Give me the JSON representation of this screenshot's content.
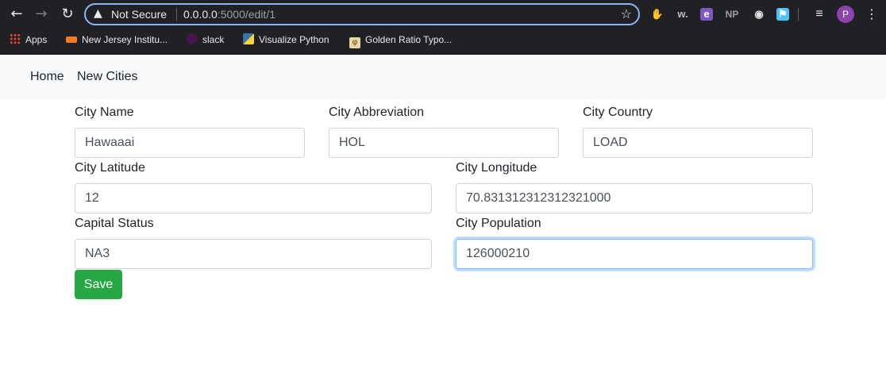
{
  "browser": {
    "security_label": "Not Secure",
    "url_host": "0.0.0.0",
    "url_rest": ":5000/edit/1",
    "profile_initial": "P",
    "bookmarks": [
      {
        "label": "Apps",
        "icon": "apps-grid-icon"
      },
      {
        "label": "New Jersey Institu...",
        "icon": "njit-icon",
        "color": "#f47b20"
      },
      {
        "label": "slack",
        "icon": "slack-icon",
        "color": "#4a154b"
      },
      {
        "label": "Visualize Python",
        "icon": "python-icon",
        "color": "#3776ab"
      },
      {
        "label": "Golden Ratio Typo...",
        "icon": "phi-icon",
        "color": "#e9d8a6"
      }
    ],
    "extensions": [
      {
        "name": "adblock-icon",
        "glyph": "✋",
        "color": "#e53935"
      },
      {
        "name": "w-extension-icon",
        "glyph": "w.",
        "color": "#bdbdbd"
      },
      {
        "name": "e-extension-icon",
        "glyph": "e",
        "color": "#7e57c2"
      },
      {
        "name": "np-extension-icon",
        "glyph": "NP",
        "color": "#9e9e9e"
      },
      {
        "name": "circle-extension-icon",
        "glyph": "◉",
        "color": "#e0e0e0"
      },
      {
        "name": "person-extension-icon",
        "glyph": "⚑",
        "color": "#4fc3f7"
      },
      {
        "name": "reading-list-icon",
        "glyph": "≡",
        "color": "#e8eaed"
      }
    ]
  },
  "navbar": {
    "home": "Home",
    "new_cities": "New Cities"
  },
  "form": {
    "city_name": {
      "label": "City Name",
      "value": "Hawaaai"
    },
    "city_abbreviation": {
      "label": "City Abbreviation",
      "value": "HOL"
    },
    "city_country": {
      "label": "City Country",
      "value": "LOAD"
    },
    "city_latitude": {
      "label": "City Latitude",
      "value": "12"
    },
    "city_longitude": {
      "label": "City Longitude",
      "value": "70.831312312312321000"
    },
    "capital_status": {
      "label": "Capital Status",
      "value": "NA3"
    },
    "city_population": {
      "label": "City Population",
      "value": "126000210"
    },
    "save_label": "Save"
  },
  "colors": {
    "save_button": "#28a745",
    "focus_border": "#80bdff",
    "navbar_bg": "#f8f9fa"
  }
}
